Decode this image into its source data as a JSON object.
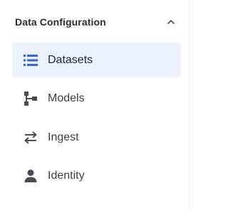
{
  "section": {
    "title": "Data Configuration",
    "expanded": true
  },
  "nav": {
    "active_index": 0,
    "items": [
      {
        "label": "Datasets",
        "icon": "list-icon",
        "active": true
      },
      {
        "label": "Models",
        "icon": "hierarchy-icon",
        "active": false
      },
      {
        "label": "Ingest",
        "icon": "swap-arrows-icon",
        "active": false
      },
      {
        "label": "Identity",
        "icon": "person-icon",
        "active": false
      }
    ]
  },
  "colors": {
    "accent": "#3b63d9",
    "active_bg": "#ebf2fd",
    "icon_gray": "#4a4d55",
    "text": "#3a3d44",
    "title": "#2b2d33"
  }
}
